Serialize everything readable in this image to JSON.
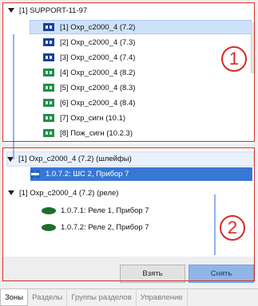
{
  "top_tree": {
    "root_label": "[1] SUPPORT-11-97",
    "items": [
      {
        "label": "[1] Охр_c2000_4 (7.2)",
        "icon": "zone-blue-icon",
        "selected": true
      },
      {
        "label": "[2] Охр_c2000_4 (7.3)",
        "icon": "zone-blue-icon"
      },
      {
        "label": "[3] Охр_c2000_4 (7.4)",
        "icon": "zone-blue-icon"
      },
      {
        "label": "[4] Охр_c2000_4 (8.2)",
        "icon": "zone-green-icon"
      },
      {
        "label": "[5] Охр_c2000_4 (8.3)",
        "icon": "zone-green-icon"
      },
      {
        "label": "[6] Охр_c2000_4 (8.4)",
        "icon": "zone-green-icon"
      },
      {
        "label": "[7] Охр_сигн (10.1)",
        "icon": "zone-green-icon"
      },
      {
        "label": "[8] Пож_сигн (10.2.3)",
        "icon": "zone-green-icon"
      }
    ]
  },
  "bottom_tree": {
    "group1_label": "[1] Охр_c2000_4 (7.2) (шлейфы)",
    "group1_items": [
      {
        "label": "1.0.7.2: ШС 2, Прибор 7",
        "icon": "loop-device-icon"
      }
    ],
    "group2_label": "[1] Охр_c2000_4 (7.2) (реле)",
    "group2_items": [
      {
        "label": "1.0.7.1: Реле 1, Прибор 7",
        "icon": "relay-icon"
      },
      {
        "label": "1.0.7.2: Реле 2, Прибор 7",
        "icon": "relay-icon"
      }
    ]
  },
  "buttons": {
    "take": "Взять",
    "remove": "Снять"
  },
  "callouts": {
    "one": "1",
    "two": "2"
  },
  "tabs": [
    "Зоны",
    "Разделы",
    "Группы разделов",
    "Управление"
  ]
}
